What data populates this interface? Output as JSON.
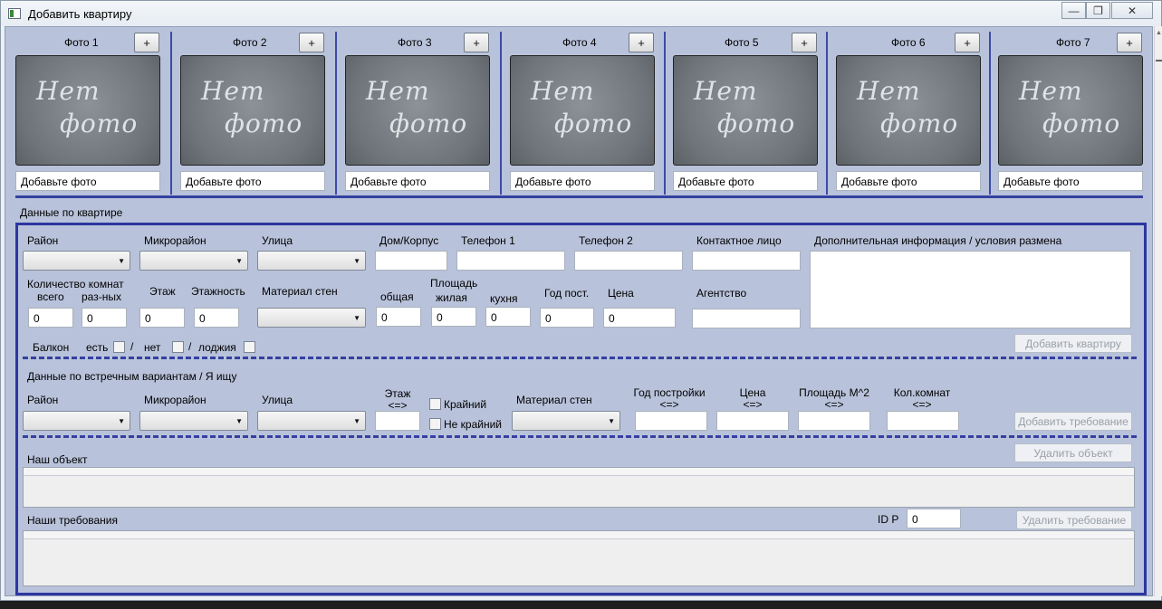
{
  "window": {
    "title": "Добавить квартиру",
    "minimize_glyph": "—",
    "restore_glyph": "❐",
    "close_glyph": "✕"
  },
  "photos": [
    {
      "label": "Фото 1",
      "add_glyph": "+",
      "placeholder_line1": "Нет",
      "placeholder_line2": "фото",
      "field": "Добавьте фото"
    },
    {
      "label": "Фото 2",
      "add_glyph": "+",
      "placeholder_line1": "Нет",
      "placeholder_line2": "фото",
      "field": "Добавьте фото"
    },
    {
      "label": "Фото 3",
      "add_glyph": "+",
      "placeholder_line1": "Нет",
      "placeholder_line2": "фото",
      "field": "Добавьте фото"
    },
    {
      "label": "Фото 4",
      "add_glyph": "+",
      "placeholder_line1": "Нет",
      "placeholder_line2": "фото",
      "field": "Добавьте фото"
    },
    {
      "label": "Фото 5",
      "add_glyph": "+",
      "placeholder_line1": "Нет",
      "placeholder_line2": "фото",
      "field": "Добавьте фото"
    },
    {
      "label": "Фото 6",
      "add_glyph": "+",
      "placeholder_line1": "Нет",
      "placeholder_line2": "фото",
      "field": "Добавьте фото"
    },
    {
      "label": "Фото 7",
      "add_glyph": "+",
      "placeholder_line1": "Нет",
      "placeholder_line2": "фото",
      "field": "Добавьте фото"
    }
  ],
  "apartment": {
    "section_title": "Данные по квартире",
    "labels": {
      "district": "Район",
      "microdistrict": "Микрорайон",
      "street": "Улица",
      "house": "Дом/Корпус",
      "phone1": "Телефон 1",
      "phone2": "Телефон 2",
      "contact": "Контактное лицо",
      "extra_info": "Дополнительная информация / условия размена",
      "rooms_count": "Количество комнат",
      "rooms_total": "всего",
      "rooms_separate": "раз-ных",
      "floor": "Этаж",
      "floors": "Этажность",
      "wall_material": "Материал стен",
      "area": "Площадь",
      "area_total": "общая",
      "area_living": "жилая",
      "area_kitchen": "кухня",
      "year_built": "Год пост.",
      "price": "Цена",
      "agency": "Агентство",
      "balcony": "Балкон",
      "balcony_yes": "есть",
      "balcony_no": "нет",
      "loggia": "лоджия",
      "slash": "/"
    },
    "values": {
      "rooms_total": "0",
      "rooms_separate": "0",
      "floor": "0",
      "floors": "0",
      "area_total": "0",
      "area_living": "0",
      "area_kitchen": "0",
      "year_built": "0",
      "price": "0"
    },
    "add_button": "Добавить квартиру"
  },
  "requirements": {
    "section_title": "Данные по встречным вариантам / Я ищу",
    "labels": {
      "district": "Район",
      "microdistrict": "Микрорайон",
      "street": "Улица",
      "floor": "Этаж",
      "range": "<=>",
      "edge": "Крайний",
      "not_edge": "Не крайний",
      "wall_material": "Материал стен",
      "year_built": "Год постройки",
      "price": "Цена",
      "area": "Площадь М^2",
      "rooms": "Кол.комнат"
    },
    "add_button": "Добавить требование"
  },
  "objects": {
    "our_object": "Наш объект",
    "delete_object": "Удалить объект",
    "our_requirements": "Наши требования",
    "id_label": "ID P",
    "id_value": "0",
    "delete_requirement": "Удалить требование"
  },
  "colors": {
    "client_bg": "#b8c2da",
    "frame": "#2d36a0",
    "separator": "#3540a0"
  }
}
